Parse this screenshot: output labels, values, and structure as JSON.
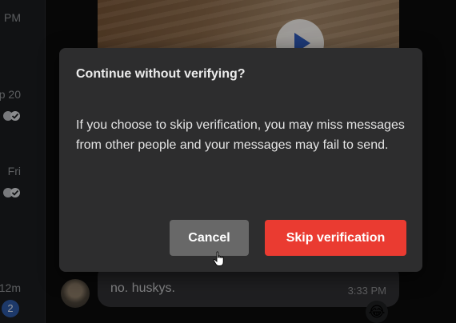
{
  "sidebar": {
    "timestamps": [
      "PM",
      "p 20",
      "Fri",
      "12m"
    ],
    "unread_badge": "2"
  },
  "chat": {
    "message_text": "no. huskys.",
    "message_time": "3:33 PM",
    "reaction_emoji": "😂"
  },
  "dialog": {
    "title": "Continue without verifying?",
    "body": "If you choose to skip verification, you may miss messages from other people and your messages may fail to send.",
    "cancel_label": "Cancel",
    "skip_label": "Skip verification"
  },
  "colors": {
    "dialog_bg": "#2d2d2e",
    "cancel_bg": "#686868",
    "skip_bg": "#ea3b31",
    "badge_bg": "#2d58a3"
  }
}
